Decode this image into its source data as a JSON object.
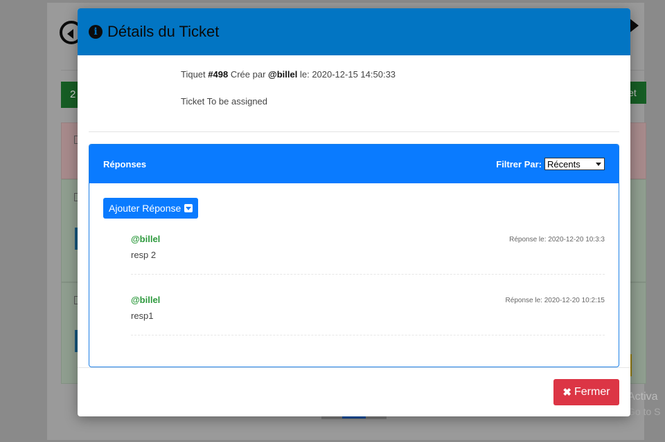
{
  "background": {
    "badge_text": "2",
    "button_text": "iet",
    "windows_activation": "Activa",
    "windows_activation_sub": "Go to S"
  },
  "modal": {
    "title": "Détails du Ticket",
    "ticket": {
      "prefix": "Tiquet",
      "number": "#498",
      "created_by_label": "Crée par",
      "author": "@billel",
      "date_label": "le:",
      "date": "2020-12-15 14:50:33",
      "description": "Ticket To be assigned"
    },
    "responses": {
      "title": "Réponses",
      "filter_label": "Filtrer Par:",
      "filter_selected": "Récents",
      "add_button_label": "Ajouter Réponse",
      "items": [
        {
          "author": "@billel",
          "date": "Réponse le: 2020-12-20 10:3:3",
          "text": "resp 2"
        },
        {
          "author": "@billel",
          "date": "Réponse le: 2020-12-20 10:2:15",
          "text": "resp1"
        }
      ]
    },
    "close_button_label": "Fermer"
  },
  "colors": {
    "header_blue": "#0275c3",
    "primary_blue": "#0a7bff",
    "author_green": "#2e9a3e",
    "danger_red": "#dc3545"
  }
}
